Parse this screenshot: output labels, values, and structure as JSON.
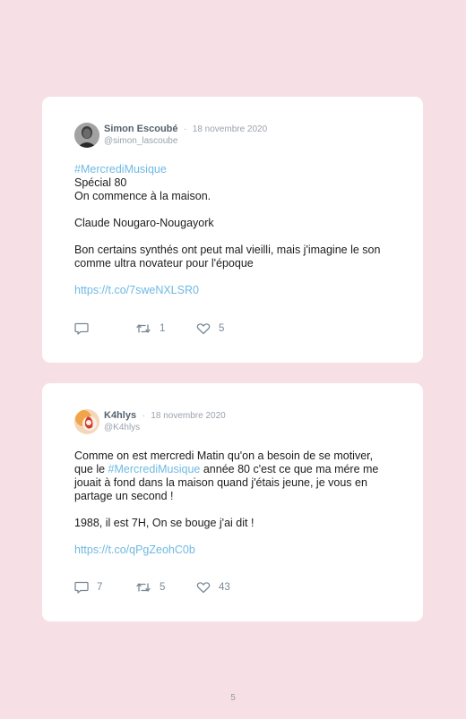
{
  "tweets": [
    {
      "author": "Simon Escoubé",
      "separator": "·",
      "date": "18 novembre 2020",
      "handle": "@simon_lascoube",
      "hashtag": "#MercrediMusique",
      "line1": "Spécial 80",
      "line2": "On commence à la maison.",
      "line3": "Claude Nougaro-Nougayork",
      "line4": "Bon certains synthés ont peut mal vieilli, mais j'imagine le son comme ultra novateur pour l'époque",
      "link": "https://t.co/7sweNXLSR0",
      "replies": "",
      "retweets": "1",
      "likes": "5"
    },
    {
      "author": "K4hlys",
      "separator": "·",
      "date": "18 novembre 2020",
      "handle": "@K4hlys",
      "text_before": "Comme on est mercredi Matin qu'on a besoin de se motiver, que le ",
      "hashtag": "#MercrediMusique",
      "text_after": " année 80 c'est ce que ma mére me jouait à fond dans la maison quand j'étais jeune, je vous en partage un second !",
      "line2": "1988, il est 7H, On se bouge j'ai dit !",
      "link": "https://t.co/qPgZeohC0b",
      "replies": "7",
      "retweets": "5",
      "likes": "43"
    }
  ],
  "page_number": "5",
  "colors": {
    "background": "#f6e0e5",
    "card": "#ffffff",
    "link": "#6fb9e2",
    "muted": "#9aa3ad",
    "name": "#56626f"
  },
  "icons": [
    "reply-icon",
    "retweet-icon",
    "like-icon"
  ]
}
